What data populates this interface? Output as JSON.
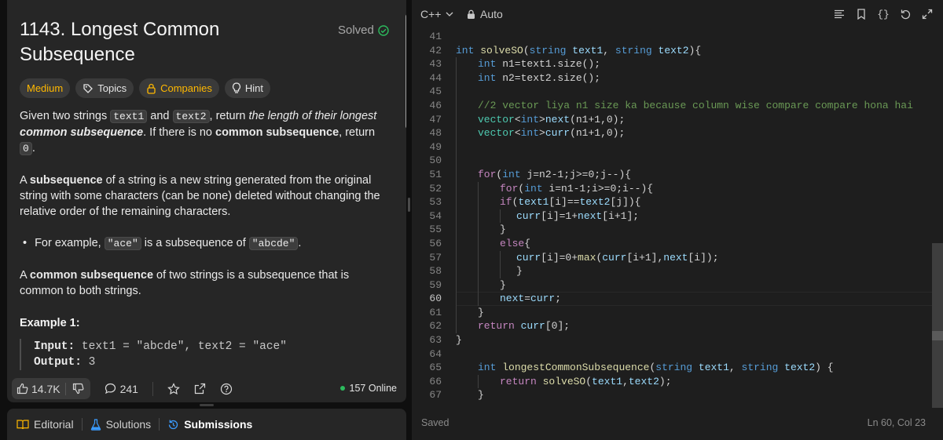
{
  "problem": {
    "title": "1143. Longest Common Subsequence",
    "status": "Solved",
    "tags": {
      "difficulty": "Medium",
      "topics": "Topics",
      "companies": "Companies",
      "hint": "Hint"
    },
    "desc": {
      "p1_a": "Given two strings ",
      "p1_code1": "text1",
      "p1_b": " and ",
      "p1_code2": "text2",
      "p1_c": ", return ",
      "p1_em": "the length of their longest ",
      "p1_em_b": "common subsequence",
      "p1_d": ". If there is no ",
      "p1_b2": "common subsequence",
      "p1_e": ", return ",
      "p1_code3": "0",
      "p1_f": ".",
      "p2_a": "A ",
      "p2_b": "subsequence",
      "p2_c": " of a string is a new string generated from the original string with some characters (can be none) deleted without changing the relative order of the remaining characters.",
      "bullet_a": "For example, ",
      "bullet_code1": "\"ace\"",
      "bullet_b": " is a subsequence of ",
      "bullet_code2": "\"abcde\"",
      "bullet_c": ".",
      "p3_a": "A ",
      "p3_b": "common subsequence",
      "p3_c": " of two strings is a subsequence that is common to both strings."
    },
    "example": {
      "title": "Example 1:",
      "input_label": "Input:",
      "input_value": " text1 = \"abcde\", text2 = \"ace\"",
      "output_label": "Output:",
      "output_value": " 3"
    }
  },
  "bottom_bar": {
    "likes": "14.7K",
    "comments": "241",
    "online": "157 Online"
  },
  "tabs": {
    "editorial": "Editorial",
    "solutions": "Solutions",
    "submissions": "Submissions"
  },
  "editor": {
    "language": "C++",
    "mode": "Auto",
    "status": "Saved",
    "cursor": "Ln 60, Col 23",
    "lines": [
      {
        "n": "41"
      },
      {
        "n": "42"
      },
      {
        "n": "43"
      },
      {
        "n": "44"
      },
      {
        "n": "45"
      },
      {
        "n": "46"
      },
      {
        "n": "47"
      },
      {
        "n": "48"
      },
      {
        "n": "49"
      },
      {
        "n": "50"
      },
      {
        "n": "51"
      },
      {
        "n": "52"
      },
      {
        "n": "53"
      },
      {
        "n": "54"
      },
      {
        "n": "55"
      },
      {
        "n": "56"
      },
      {
        "n": "57"
      },
      {
        "n": "58"
      },
      {
        "n": "59"
      },
      {
        "n": "60"
      },
      {
        "n": "61"
      },
      {
        "n": "62"
      },
      {
        "n": "63"
      },
      {
        "n": "64"
      },
      {
        "n": "65"
      },
      {
        "n": "66"
      },
      {
        "n": "67"
      }
    ],
    "code": {
      "l42_kw": "int",
      "l42_fn": "solveSO",
      "l42_rest1": "(",
      "l42_ty1": "string",
      "l42_v1": "text1",
      "l42_rest2": ", ",
      "l42_ty2": "string",
      "l42_v2": "text2",
      "l42_rest3": "){",
      "l43_kw": "int",
      "l43_rest": " n1=text1.size();",
      "l44_kw": "int",
      "l44_rest": " n2=text2.size();",
      "l46_cm": "//2 vector liya n1 size ka because column wise compare compare hona hai",
      "l47": "vector<int>next(n1+1,0);",
      "l48": "vector<int>curr(n1+1,0);",
      "l51": "for(int j=n2-1;j>=0;j--){",
      "l52": "for(int i=n1-1;i>=0;i--){",
      "l53": "if(text1[i]==text2[j]){",
      "l54": "curr[i]=1+next[i+1];",
      "l55": "}",
      "l56": "else{",
      "l57": "curr[i]=0+max(curr[i+1],next[i]);",
      "l58": "}",
      "l59": "}",
      "l60": "next=curr;",
      "l61": "}",
      "l62": "return curr[0];",
      "l63": "}",
      "l65": "int longestCommonSubsequence(string text1, string text2) {",
      "l66": "return solveSO(text1,text2);",
      "l67": "}"
    }
  }
}
